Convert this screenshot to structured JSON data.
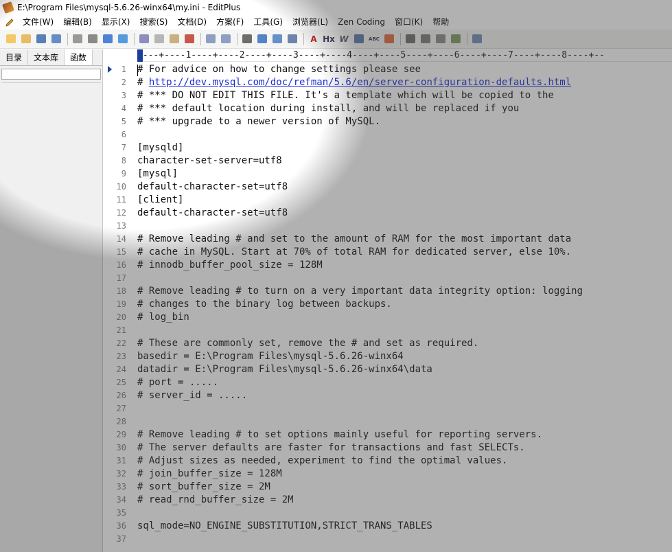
{
  "window": {
    "title": "E:\\Program Files\\mysql-5.6.26-winx64\\my.ini - EditPlus"
  },
  "menu": [
    "文件(W)",
    "编辑(B)",
    "显示(X)",
    "搜索(S)",
    "文档(D)",
    "方案(F)",
    "工具(G)",
    "浏览器(L)",
    "Zen Coding",
    "窗口(K)",
    "帮助"
  ],
  "toolbar": {
    "icons": [
      "new-file-icon",
      "open-icon",
      "save-icon",
      "save-all-icon",
      "print-preview-icon",
      "print-icon",
      "spellcheck-icon",
      "browser-icon",
      "cut-icon",
      "copy-icon",
      "paste-icon",
      "delete-icon",
      "undo-icon",
      "redo-icon",
      "find-icon",
      "replace-icon",
      "goto-icon",
      "indent-icon",
      "font-icon",
      "heading-icon",
      "word-wrap-icon",
      "line-number-icon",
      "column-icon",
      "check-icon",
      "window-icon",
      "split-icon",
      "output-icon",
      "tools-icon",
      "help-icon"
    ],
    "labels": {
      "font": "A",
      "heading": "Hx",
      "wrap": "W",
      "spell": "ABC"
    }
  },
  "sidebar": {
    "tabs": [
      "目录",
      "文本库",
      "函数"
    ],
    "active_tab": "函数"
  },
  "editor": {
    "ruler": "----+----1----+----2----+----3----+----4----+----5----+----6----+----7----+----8----+--",
    "lines": [
      {
        "n": "1",
        "text": "# For advice on how to change settings please see"
      },
      {
        "n": "2",
        "prefix": "# ",
        "link": "http://dev.mysql.com/doc/refman/5.6/en/server-configuration-defaults.html"
      },
      {
        "n": "3",
        "text": "# *** DO NOT EDIT THIS FILE. It's a template which will be copied to the"
      },
      {
        "n": "4",
        "text": "# *** default location during install, and will be replaced if you"
      },
      {
        "n": "5",
        "text": "# *** upgrade to a newer version of MySQL."
      },
      {
        "n": "6",
        "text": ""
      },
      {
        "n": "7",
        "text": "[mysqld]"
      },
      {
        "n": "8",
        "text": "character-set-server=utf8"
      },
      {
        "n": "9",
        "text": "[mysql]"
      },
      {
        "n": "10",
        "text": "default-character-set=utf8"
      },
      {
        "n": "11",
        "text": "[client]"
      },
      {
        "n": "12",
        "text": "default-character-set=utf8"
      },
      {
        "n": "13",
        "text": ""
      },
      {
        "n": "14",
        "text": "# Remove leading # and set to the amount of RAM for the most important data"
      },
      {
        "n": "15",
        "text": "# cache in MySQL. Start at 70% of total RAM for dedicated server, else 10%."
      },
      {
        "n": "16",
        "text": "# innodb_buffer_pool_size = 128M"
      },
      {
        "n": "17",
        "text": ""
      },
      {
        "n": "18",
        "text": "# Remove leading # to turn on a very important data integrity option: logging"
      },
      {
        "n": "19",
        "text": "# changes to the binary log between backups."
      },
      {
        "n": "20",
        "text": "# log_bin"
      },
      {
        "n": "21",
        "text": ""
      },
      {
        "n": "22",
        "text": "# These are commonly set, remove the # and set as required."
      },
      {
        "n": "23",
        "text": "basedir = E:\\Program Files\\mysql-5.6.26-winx64"
      },
      {
        "n": "24",
        "text": "datadir = E:\\Program Files\\mysql-5.6.26-winx64\\data"
      },
      {
        "n": "25",
        "text": "# port = ....."
      },
      {
        "n": "26",
        "text": "# server_id = ....."
      },
      {
        "n": "27",
        "text": ""
      },
      {
        "n": "28",
        "text": ""
      },
      {
        "n": "29",
        "text": "# Remove leading # to set options mainly useful for reporting servers."
      },
      {
        "n": "30",
        "text": "# The server defaults are faster for transactions and fast SELECTs."
      },
      {
        "n": "31",
        "text": "# Adjust sizes as needed, experiment to find the optimal values."
      },
      {
        "n": "32",
        "text": "# join_buffer_size = 128M"
      },
      {
        "n": "33",
        "text": "# sort_buffer_size = 2M"
      },
      {
        "n": "34",
        "text": "# read_rnd_buffer_size = 2M"
      },
      {
        "n": "35",
        "text": ""
      },
      {
        "n": "36",
        "text": "sql_mode=NO_ENGINE_SUBSTITUTION,STRICT_TRANS_TABLES"
      },
      {
        "n": "37",
        "text": ""
      }
    ]
  },
  "colors": {
    "link": "#1a2cd6",
    "caret": "#1c3f9e",
    "line_numbers": "#7a7a7a"
  }
}
